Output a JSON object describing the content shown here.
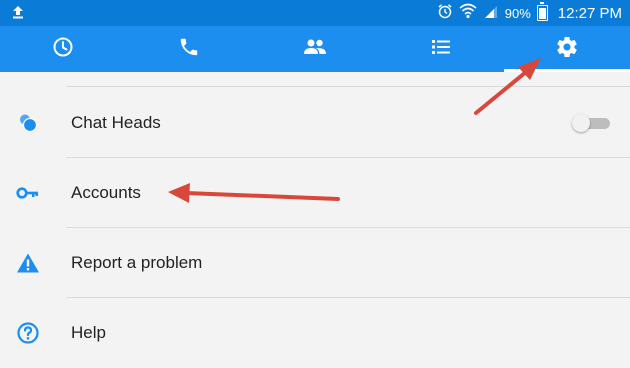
{
  "status_bar": {
    "upload_icon": "upload-icon",
    "alarm_icon": "alarm-icon",
    "wifi_icon": "wifi-icon",
    "signal_icon": "signal-icon",
    "battery_percent": "90%",
    "time": "12:27 PM"
  },
  "tabs": [
    {
      "icon": "clock-icon",
      "active": false
    },
    {
      "icon": "phone-icon",
      "active": false
    },
    {
      "icon": "people-icon",
      "active": false
    },
    {
      "icon": "list-icon",
      "active": false
    },
    {
      "icon": "gear-icon",
      "active": true
    }
  ],
  "settings": [
    {
      "label": "Chat Heads",
      "icon": "chat-heads-icon",
      "toggle": "off"
    },
    {
      "label": "Accounts",
      "icon": "key-icon"
    },
    {
      "label": "Report a problem",
      "icon": "warning-icon"
    },
    {
      "label": "Help",
      "icon": "help-icon"
    }
  ],
  "colors": {
    "status_bar": "#0a7cd8",
    "tab_bar": "#1b8ef0",
    "icon_blue": "#1b8ef0",
    "arrow_red": "#d9473c"
  }
}
